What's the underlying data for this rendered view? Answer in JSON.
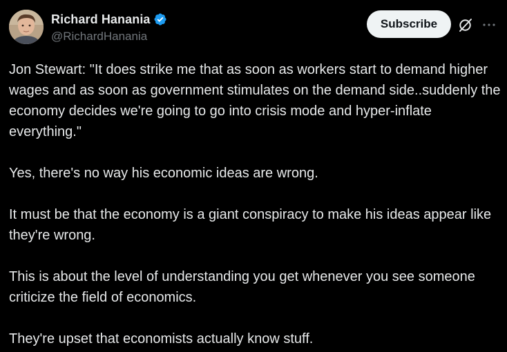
{
  "author": {
    "display_name": "Richard Hanania",
    "handle": "@RichardHanania",
    "verified": true,
    "verified_color": "#1d9bf0"
  },
  "actions": {
    "subscribe_label": "Subscribe",
    "grok_icon": "grok-icon",
    "more_icon": "more-horizontal-icon"
  },
  "post": {
    "paragraphs": [
      "Jon Stewart: \"It does strike me that as soon as workers start to demand higher wages and as soon as government stimulates on the demand side..suddenly the economy decides we're going to go into crisis mode and hyper-inflate everything.\"",
      "Yes, there's no way his economic ideas are wrong.",
      "It must be that the economy is a giant conspiracy to make his ideas appear like they're wrong.",
      "This is about the level of understanding you get whenever you see someone criticize the field of economics.",
      "They're upset that economists actually know stuff."
    ]
  },
  "theme": {
    "background": "#000000",
    "text_primary": "#e7e9ea",
    "text_secondary": "#71767b",
    "button_bg": "#eff3f4",
    "button_text": "#0f1419"
  }
}
